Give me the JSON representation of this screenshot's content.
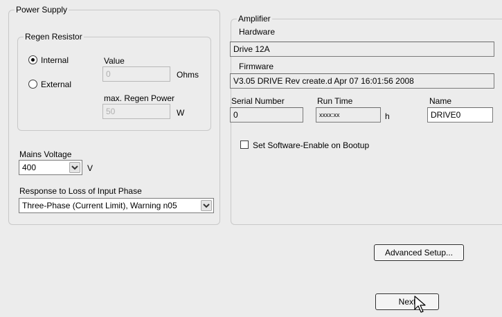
{
  "power_supply": {
    "legend": "Power Supply",
    "regen": {
      "legend": "Regen Resistor",
      "internal_label": "Internal",
      "external_label": "External",
      "selected": "internal",
      "value_label": "Value",
      "value": "0",
      "value_unit": "Ohms",
      "max_power_label": "max. Regen Power",
      "max_power": "50",
      "max_power_unit": "W"
    },
    "mains_voltage_label": "Mains Voltage",
    "mains_voltage": "400",
    "mains_voltage_unit": "V",
    "phase_loss_label": "Response to Loss of Input Phase",
    "phase_loss_value": "Three-Phase (Current Limit), Warning n05"
  },
  "amplifier": {
    "legend": "Amplifier",
    "hardware_label": "Hardware",
    "hardware": "Drive 12A",
    "firmware_label": "Firmware",
    "firmware": "V3.05 DRIVE Rev create.d Apr 07 16:01:56 2008",
    "serial_label": "Serial Number",
    "serial": "0",
    "runtime_label": "Run Time",
    "runtime": "xxxx:xx",
    "runtime_unit": "h",
    "name_label": "Name",
    "name": "DRIVE0",
    "software_enable_label": "Set Software-Enable on Bootup",
    "software_enable_checked": false
  },
  "buttons": {
    "advanced_setup": "Advanced Setup...",
    "next": "Next"
  },
  "icons": {
    "dropdown": "chevron-down-icon",
    "cursor": "hand-pointer-icon"
  }
}
